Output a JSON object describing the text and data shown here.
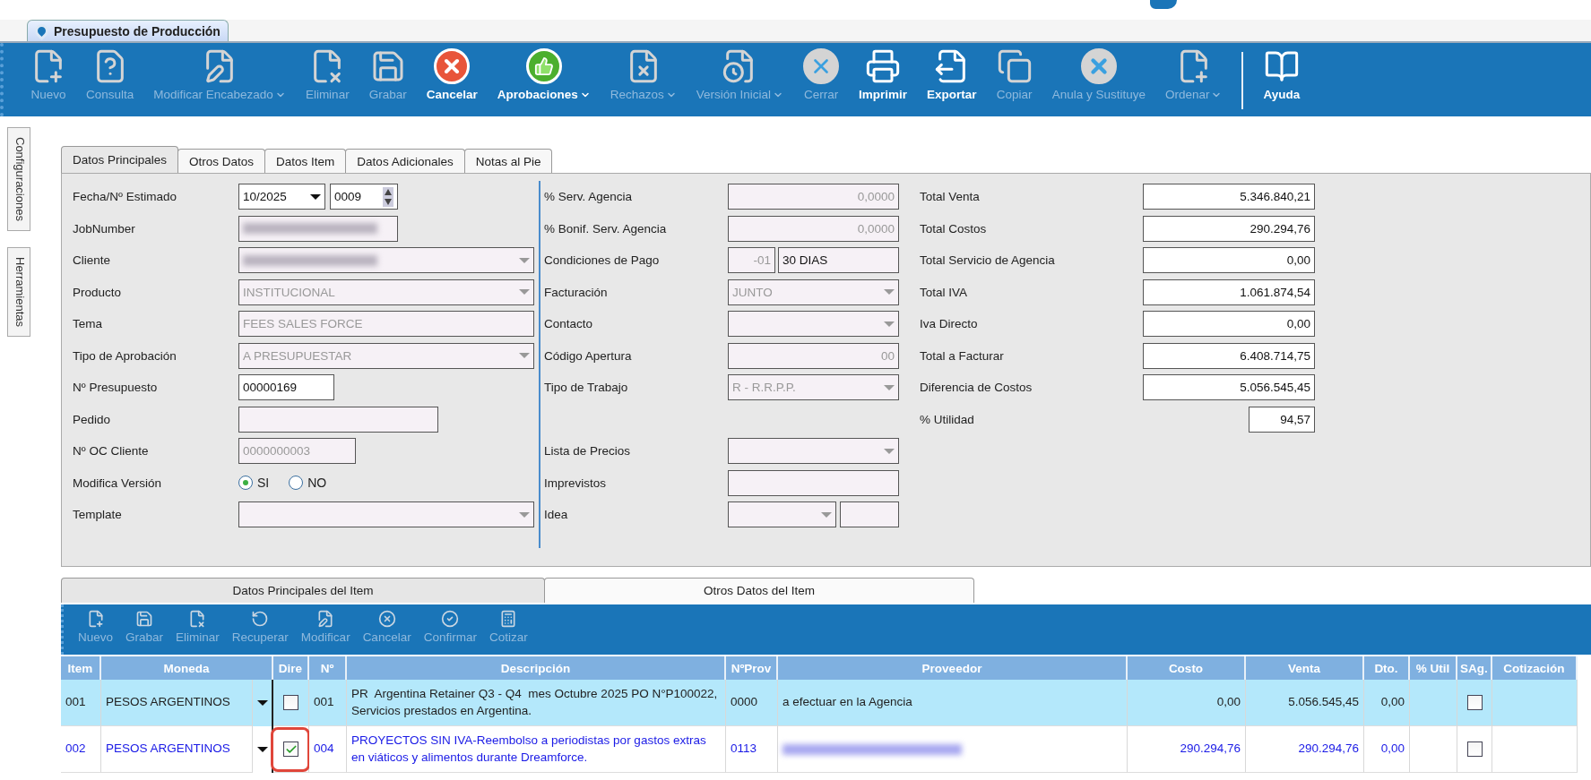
{
  "window": {
    "tab_title": "Presupuesto de Producción"
  },
  "toolbar": [
    {
      "kind": "new",
      "label": "Nuevo",
      "disabled": true,
      "dropdown": false
    },
    {
      "kind": "query",
      "label": "Consulta",
      "disabled": true,
      "dropdown": false
    },
    {
      "kind": "edit",
      "label": "Modificar Encabezado",
      "disabled": true,
      "dropdown": true
    },
    {
      "kind": "delete",
      "label": "Eliminar",
      "disabled": true,
      "dropdown": false
    },
    {
      "kind": "save",
      "label": "Grabar",
      "disabled": true,
      "dropdown": false
    },
    {
      "kind": "cancel",
      "label": "Cancelar",
      "disabled": false,
      "dropdown": false
    },
    {
      "kind": "approve",
      "label": "Aprobaciones",
      "disabled": false,
      "dropdown": true
    },
    {
      "kind": "reject",
      "label": "Rechazos",
      "disabled": true,
      "dropdown": true
    },
    {
      "kind": "version",
      "label": "Versión Inicial",
      "disabled": true,
      "dropdown": true
    },
    {
      "kind": "close",
      "label": "Cerrar",
      "disabled": true,
      "dropdown": false
    },
    {
      "kind": "print",
      "label": "Imprimir",
      "disabled": false,
      "dropdown": false
    },
    {
      "kind": "export",
      "label": "Exportar",
      "disabled": false,
      "dropdown": false
    },
    {
      "kind": "copy",
      "label": "Copiar",
      "disabled": true,
      "dropdown": false
    },
    {
      "kind": "void",
      "label": "Anula y Sustituye",
      "disabled": true,
      "dropdown": false
    },
    {
      "kind": "order",
      "label": "Ordenar",
      "disabled": true,
      "dropdown": true
    },
    {
      "kind": "help",
      "label": "Ayuda",
      "disabled": false,
      "dropdown": false
    }
  ],
  "side_tabs": [
    {
      "label": "Configuraciones"
    },
    {
      "label": "Herramientas"
    }
  ],
  "form_tabs": [
    {
      "label": "Datos Principales",
      "selected": true
    },
    {
      "label": "Otros Datos",
      "selected": false
    },
    {
      "label": "Datos Item",
      "selected": false
    },
    {
      "label": "Datos Adicionales",
      "selected": false
    },
    {
      "label": "Notas al Pie",
      "selected": false
    }
  ],
  "left_fields": [
    {
      "label": "Fecha/Nº Estimado",
      "kind": "date_spin",
      "value": "10/2025",
      "number": "0009",
      "disabled": false
    },
    {
      "label": "JobNumber",
      "kind": "text",
      "redacted": true,
      "disabled": true
    },
    {
      "label": "Cliente",
      "kind": "combo",
      "redacted": true,
      "disabled": true
    },
    {
      "label": "Producto",
      "kind": "combo",
      "value": "INSTITUCIONAL",
      "disabled": true
    },
    {
      "label": "Tema",
      "kind": "text",
      "value": "FEES SALES FORCE",
      "disabled": true
    },
    {
      "label": "Tipo de Aprobación",
      "kind": "combo",
      "value": "A PRESUPUESTAR",
      "disabled": true
    },
    {
      "label": "Nº Presupuesto",
      "kind": "text",
      "value": "00000169",
      "disabled": false
    },
    {
      "label": "Pedido",
      "kind": "text",
      "disabled": true
    },
    {
      "label": "Nº OC Cliente",
      "kind": "text",
      "value": "0000000003",
      "disabled": true
    },
    {
      "label": "Modifica Versión",
      "kind": "radio",
      "options": [
        {
          "label": "SI",
          "selected": true
        },
        {
          "label": "NO",
          "selected": false
        }
      ]
    },
    {
      "label": "Template",
      "kind": "combo",
      "disabled": true
    }
  ],
  "middle_fields": [
    {
      "label": "% Serv. Agencia",
      "kind": "number",
      "value": "0,0000",
      "disabled": true
    },
    {
      "label": "% Bonif. Serv. Agencia",
      "kind": "number",
      "value": "0,0000",
      "disabled": true
    },
    {
      "label": "Condiciones de Pago",
      "kind": "code_text",
      "code": "-01",
      "value": "30 DIAS",
      "disabled": true
    },
    {
      "label": "Facturación",
      "kind": "combo",
      "value": "JUNTO",
      "disabled": true
    },
    {
      "label": "Contacto",
      "kind": "combo",
      "disabled": true
    },
    {
      "label": "Código Apertura",
      "kind": "number",
      "value": "00",
      "disabled": true
    },
    {
      "label": "Tipo de Trabajo",
      "kind": "combo",
      "value": "R - R.R.P.P.",
      "disabled": true
    },
    {
      "label": "Lista de Precios",
      "kind": "combo",
      "disabled": true
    },
    {
      "label": "Imprevistos",
      "kind": "text",
      "disabled": true
    },
    {
      "label": "Idea",
      "kind": "combo_text",
      "disabled": true
    }
  ],
  "totals": [
    {
      "label": "Total Venta",
      "value": "5.346.840,21"
    },
    {
      "label": "Total Costos",
      "value": "290.294,76"
    },
    {
      "label": "Total Servicio de Agencia",
      "value": "0,00"
    },
    {
      "label": "Total IVA",
      "value": "1.061.874,54"
    },
    {
      "label": "Iva Directo",
      "value": "0,00"
    },
    {
      "label": "Total a Facturar",
      "value": "6.408.714,75"
    },
    {
      "label": "Diferencia de Costos",
      "value": "5.056.545,45"
    },
    {
      "label": "% Utilidad",
      "value": "94,57"
    }
  ],
  "item_tabs": [
    {
      "label": "Datos Principales del Item",
      "selected": false
    },
    {
      "label": "Otros Datos del Item",
      "selected": true
    }
  ],
  "item_toolbar": [
    {
      "kind": "new",
      "label": "Nuevo",
      "disabled": true
    },
    {
      "kind": "save",
      "label": "Grabar",
      "disabled": true
    },
    {
      "kind": "delete",
      "label": "Eliminar",
      "disabled": true
    },
    {
      "kind": "recover",
      "label": "Recuperar",
      "disabled": true
    },
    {
      "kind": "edit",
      "label": "Modificar",
      "disabled": true
    },
    {
      "kind": "cancel",
      "label": "Cancelar",
      "disabled": true
    },
    {
      "kind": "confirm",
      "label": "Confirmar",
      "disabled": true
    },
    {
      "kind": "quote",
      "label": "Cotizar",
      "disabled": true
    }
  ],
  "table": {
    "columns": [
      "Item",
      "Moneda",
      "Dire",
      "Nº",
      "Descripción",
      "NºProv",
      "Proveedor",
      "Costo",
      "Venta",
      "Dto.",
      "% Util",
      "SAg.",
      "Cotización"
    ],
    "rows": [
      {
        "selected": true,
        "edited": false,
        "item": "001",
        "moneda": "PESOS ARGENTINOS",
        "dire": false,
        "highlighted": false,
        "numero": "001",
        "descripcion": "PR  Argentina Retainer Q3 - Q4  mes Octubre 2025 PO N°P100022, Servicios prestados en Argentina.",
        "nro_prov": "0000",
        "proveedor": "a efectuar en la Agencia",
        "proveedor_redacted": false,
        "costo": "0,00",
        "venta": "5.056.545,45",
        "dto": "0,00",
        "sag": false
      },
      {
        "selected": false,
        "edited": true,
        "item": "002",
        "moneda": "PESOS ARGENTINOS",
        "dire": true,
        "highlighted": true,
        "numero": "004",
        "descripcion": "PROYECTOS SIN IVA-Reembolso a periodistas por gastos extras en viáticos y alimentos durante Dreamforce.",
        "nro_prov": "0113",
        "proveedor_redacted": true,
        "costo": "290.294,76",
        "venta": "290.294,76",
        "dto": "0,00",
        "sag": false
      }
    ]
  }
}
